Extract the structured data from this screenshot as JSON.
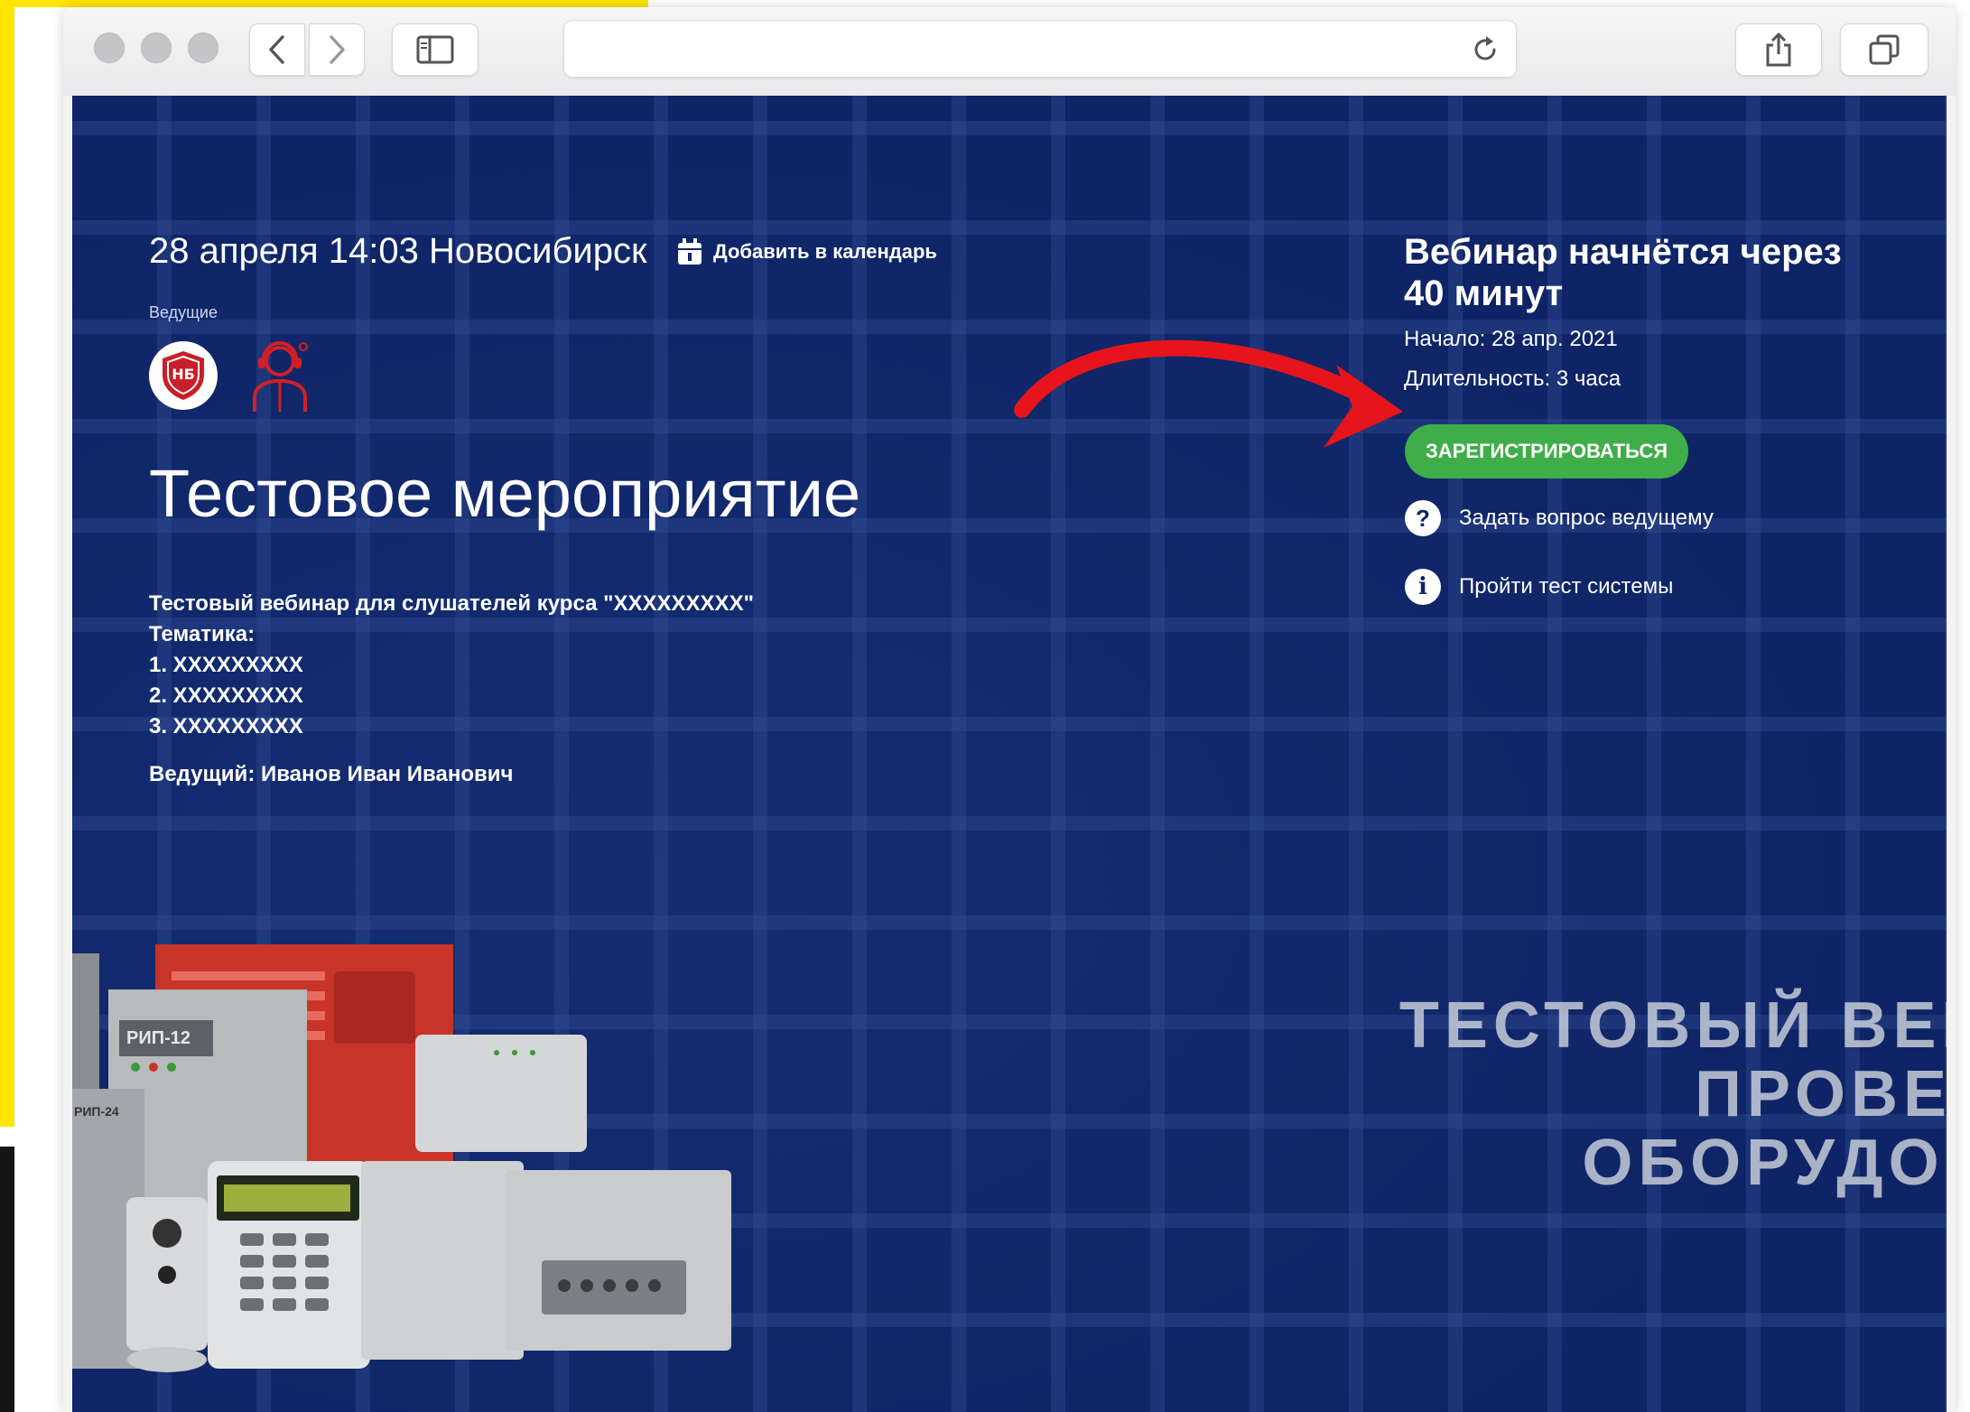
{
  "browser": {
    "url": ""
  },
  "event": {
    "date_location": "28 апреля 14:03 Новосибирск",
    "calendar_link": "Добавить в календарь",
    "hosts_label": "Ведущие",
    "host_badge_text": "НБ",
    "title": "Тестовое мероприятие",
    "description_lines": [
      "Тестовый вебинар для слушателей курса \"XXXXXXXXX\"",
      "Тематика:",
      "1. XXXXXXXXX",
      "2. XXXXXXXXX",
      "3. XXXXXXXXX"
    ],
    "host_line": "Ведущий: Иванов Иван Иванович"
  },
  "sidebar": {
    "countdown": "Вебинар начнётся через 40 минут",
    "start": "Начало: 28 апр. 2021",
    "duration": "Длительность: 3 часа",
    "register_button": "ЗАРЕГИСТРИРОВАТЬСЯ",
    "ask_question": "Задать вопрос ведущему",
    "system_test": "Пройти тест системы",
    "question_icon_glyph": "?",
    "info_icon_glyph": "i"
  },
  "banner": {
    "lines": [
      "ТЕСТОВЫЙ ВЕБИ",
      "ПРОВЕРК",
      "ОБОРУДОВА"
    ]
  },
  "equipment_labels": {
    "rip12": "РИП-12",
    "rip24": "РИП-24"
  },
  "colors": {
    "page_background": "#0e2466",
    "accent_green": "#3fae49",
    "arrow_red": "#e8141c",
    "yellow_frame": "#ffe600"
  }
}
